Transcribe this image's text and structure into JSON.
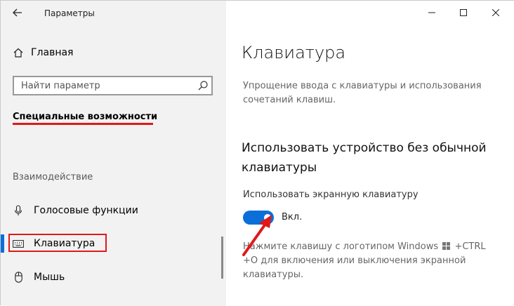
{
  "window": {
    "title": "Параметры"
  },
  "sidebar": {
    "home_label": "Главная",
    "search_placeholder": "Найти параметр",
    "section_title": "Специальные возможности",
    "group_label": "Взаимодействие",
    "items": [
      {
        "label": "Голосовые функции",
        "icon": "microphone-icon"
      },
      {
        "label": "Клавиатура",
        "icon": "keyboard-icon",
        "selected": true
      },
      {
        "label": "Мышь",
        "icon": "mouse-icon"
      }
    ]
  },
  "main": {
    "page_title": "Клавиатура",
    "description": "Упрощение ввода с клавиатуры и использования сочетаний клавиш.",
    "sub_heading": "Использовать устройство без обычной клавиатуры",
    "toggle_caption": "Использовать экранную клавиатуру",
    "toggle_state": "Вкл.",
    "hint_before": "Нажмите клавишу с логотипом Windows",
    "hint_after": "+CTRL +O для включения или выключения экранной клавиатуры."
  },
  "colors": {
    "accent": "#0a6fd8",
    "annotation_red": "#e01919",
    "sidebar_bg": "#f2f2f2"
  }
}
